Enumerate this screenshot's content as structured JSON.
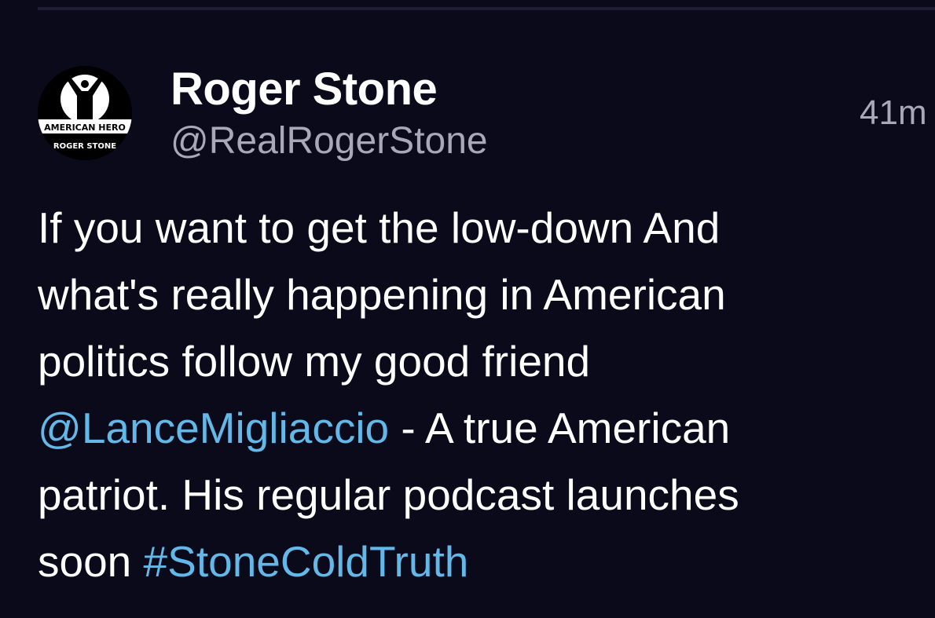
{
  "post": {
    "author": {
      "display_name": "Roger Stone",
      "handle": "@RealRogerStone",
      "avatar": {
        "line1": "AMERICAN HERO",
        "line2": "ROGER STONE"
      }
    },
    "timestamp": "41m",
    "body": {
      "line1": "If you want to get the low-down And",
      "line2": "what's really happening in American",
      "line3": "politics follow my good friend",
      "mention": "@LanceMigliaccio",
      "line4_rest": " - A true American",
      "line5": "patriot. His regular podcast launches",
      "line6_start": "soon ",
      "hashtag": "#StoneColdTruth"
    }
  },
  "colors": {
    "background": "#0b0a1b",
    "text": "#ffffff",
    "muted": "#a9a8b8",
    "link": "#63b8e8",
    "divider": "#1e1d33"
  }
}
